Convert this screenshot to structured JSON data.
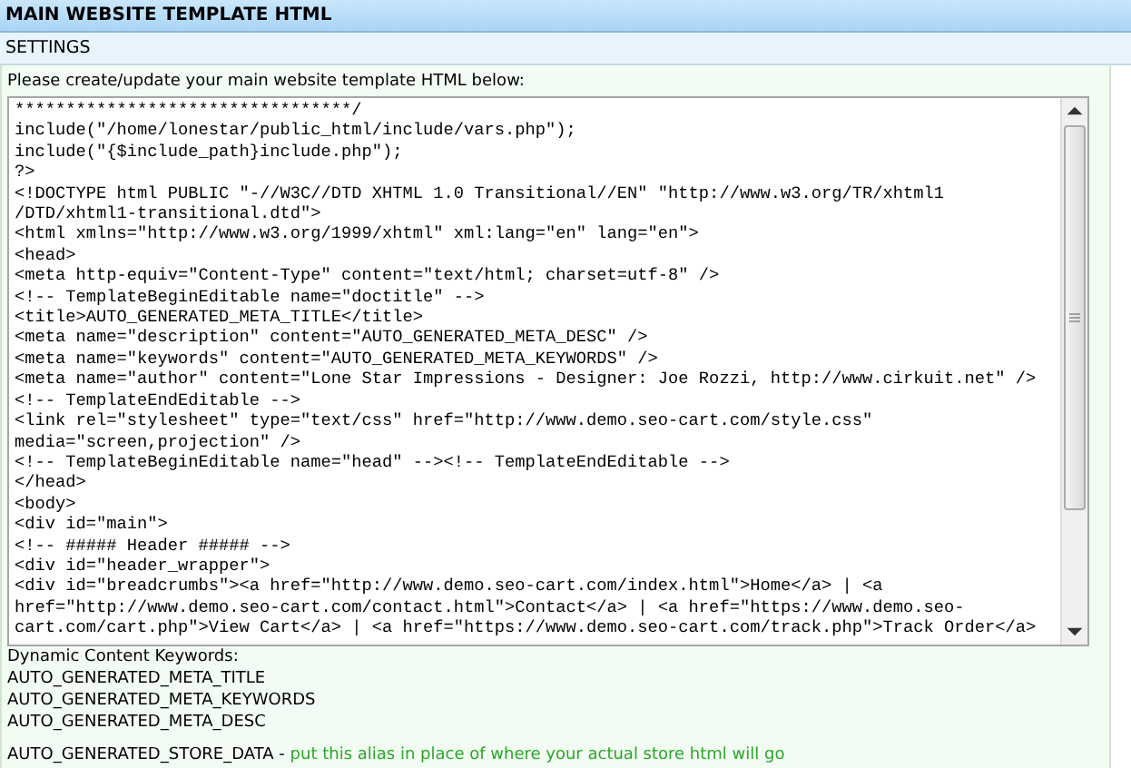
{
  "window": {
    "title": "MAIN WEBSITE TEMPLATE HTML"
  },
  "section": {
    "title": "SETTINGS"
  },
  "prompt": "Please create/update your main website template HTML below:",
  "editor": {
    "lines": [
      "*********************************/",
      "include(\"/home/lonestar/public_html/include/vars.php\");",
      "include(\"{$include_path}include.php\");",
      "?>",
      "<!DOCTYPE html PUBLIC \"-//W3C//DTD XHTML 1.0 Transitional//EN\" \"http://www.w3.org/TR/xhtml1",
      "/DTD/xhtml1-transitional.dtd\">",
      "<html xmlns=\"http://www.w3.org/1999/xhtml\" xml:lang=\"en\" lang=\"en\">",
      "<head>",
      "<meta http-equiv=\"Content-Type\" content=\"text/html; charset=utf-8\" />",
      "<!-- TemplateBeginEditable name=\"doctitle\" -->",
      "<title>AUTO_GENERATED_META_TITLE</title>",
      "<meta name=\"description\" content=\"AUTO_GENERATED_META_DESC\" />",
      "<meta name=\"keywords\" content=\"AUTO_GENERATED_META_KEYWORDS\" />",
      "<meta name=\"author\" content=\"Lone Star Impressions - Designer: Joe Rozzi, http://www.cirkuit.net\" />",
      "<!-- TemplateEndEditable -->",
      "<link rel=\"stylesheet\" type=\"text/css\" href=\"http://www.demo.seo-cart.com/style.css\"",
      "media=\"screen,projection\" />",
      "<!-- TemplateBeginEditable name=\"head\" --><!-- TemplateEndEditable -->",
      "</head>",
      "<body>",
      "<div id=\"main\">",
      "<!-- ##### Header ##### -->",
      "<div id=\"header_wrapper\">",
      "<div id=\"breadcrumbs\"><a href=\"http://www.demo.seo-cart.com/index.html\">Home</a> | <a",
      "href=\"http://www.demo.seo-cart.com/contact.html\">Contact</a> | <a href=\"https://www.demo.seo-",
      "cart.com/cart.php\">View Cart</a> | <a href=\"https://www.demo.seo-cart.com/track.php\">Track Order</a>"
    ]
  },
  "keywords": {
    "heading": "Dynamic Content Keywords:",
    "items": [
      "AUTO_GENERATED_META_TITLE",
      "AUTO_GENERATED_META_KEYWORDS",
      "AUTO_GENERATED_META_DESC"
    ]
  },
  "store_alias": {
    "keyword": "AUTO_GENERATED_STORE_DATA -",
    "note": "put this alias in place of where your actual store html will go"
  }
}
